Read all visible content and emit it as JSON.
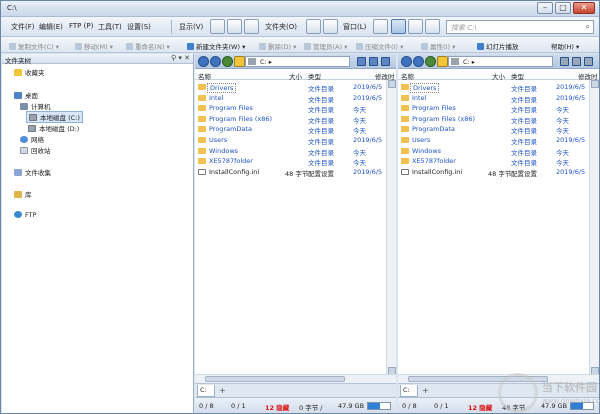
{
  "window": {
    "title": "C:\\"
  },
  "menu": [
    "文件(F)",
    "编辑(E)",
    "FTP (P)",
    "工具(T)",
    "设置(S)"
  ],
  "menu_right": {
    "display": "显示(V)",
    "folder": "文件夹(O)",
    "window": "窗口(L)"
  },
  "search": {
    "placeholder": "搜索 C:\\"
  },
  "toolbar2": {
    "copy": "复制文件(C)",
    "move": "移动(M)",
    "rename": "重命名(N)",
    "newfolder": "新建文件夹(W)",
    "delete": "删除(D)",
    "admin": "管理员(A)",
    "compress": "压缩文件(I)",
    "props": "属性(I)",
    "slideshow": "幻灯片播放",
    "help": "帮助(H)"
  },
  "tree": {
    "header": "文件夹树",
    "favorites": "收藏夹",
    "desktop": "桌面",
    "computer": "计算机",
    "drive_c": "本地磁盘 (C:)",
    "drive_d": "本地磁盘 (D:)",
    "network": "网络",
    "recycle": "回收站",
    "collections": "文件收集",
    "library": "库",
    "ftp": "FTP"
  },
  "pane": {
    "address": "C:",
    "cols": {
      "name": "名称",
      "size": "大小",
      "type": "类型",
      "modified": "修改时"
    },
    "rows": [
      {
        "name": "Drivers",
        "size": "",
        "type": "文件目录",
        "date": "2019/6/5"
      },
      {
        "name": "Intel",
        "size": "",
        "type": "文件目录",
        "date": "2019/6/5"
      },
      {
        "name": "Program Files",
        "size": "",
        "type": "文件目录",
        "date": "今天"
      },
      {
        "name": "Program Files (x86)",
        "size": "",
        "type": "文件目录",
        "date": "今天"
      },
      {
        "name": "ProgramData",
        "size": "",
        "type": "文件目录",
        "date": "今天"
      },
      {
        "name": "Users",
        "size": "",
        "type": "文件目录",
        "date": "2019/6/5"
      },
      {
        "name": "Windows",
        "size": "",
        "type": "文件目录",
        "date": "今天"
      },
      {
        "name": "XE5787folder",
        "size": "",
        "type": "文件目录",
        "date": "今天"
      },
      {
        "name": "InstallConfig.ini",
        "size": "48 字节",
        "type": "配置设置",
        "date": "2019/6/5"
      }
    ],
    "tab": "C:",
    "status": {
      "items": "0 / 8",
      "files": "0 / 1",
      "hidden": "12 隐藏",
      "bytes": "0 字节 /",
      "free": "47.9 GB"
    },
    "status2": {
      "bytes": "48 字节"
    },
    "free_fraction": 0.55
  },
  "watermark": {
    "line1": "当下软件园",
    "line2": "www.downxia.com"
  }
}
